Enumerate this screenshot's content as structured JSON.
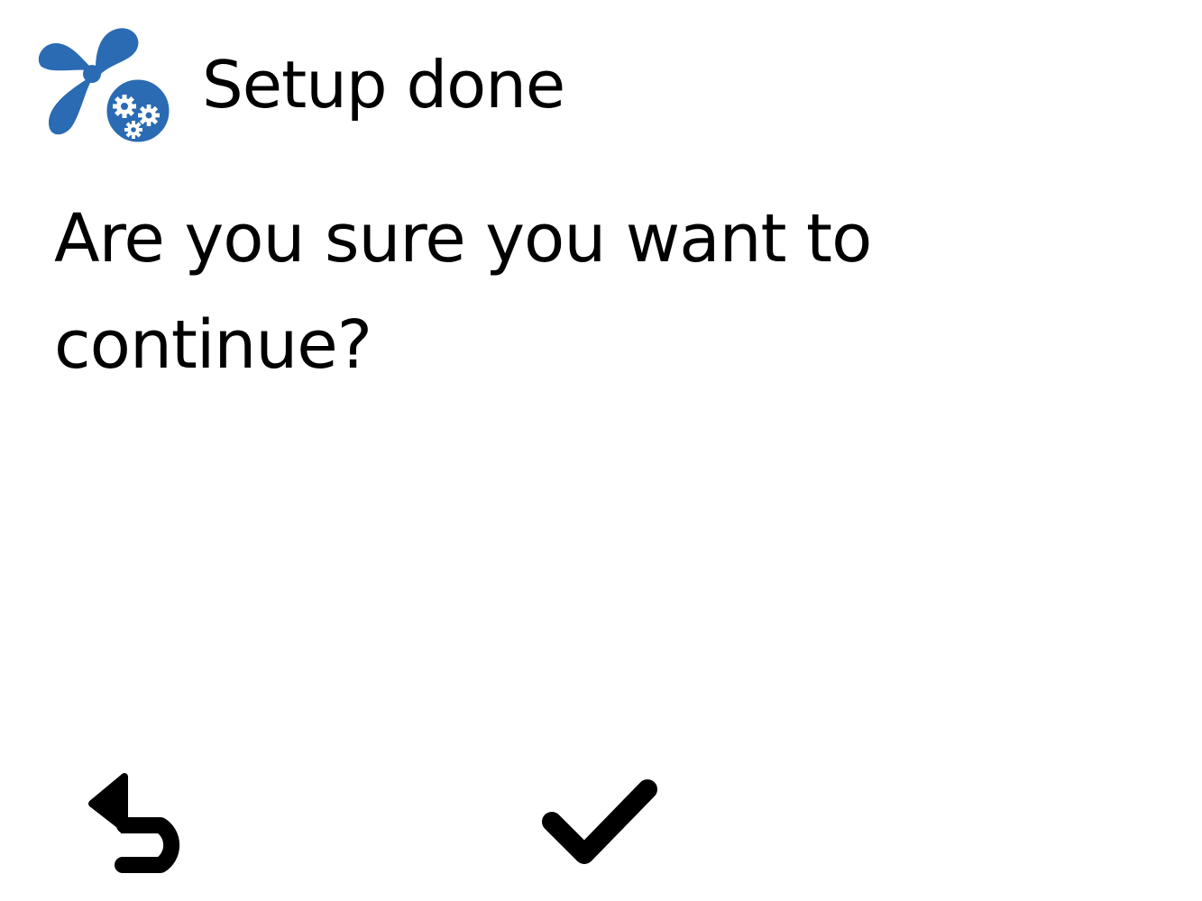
{
  "header": {
    "title": "Setup done",
    "icon": "fan-gears-icon",
    "icon_color": "#2a6bb3"
  },
  "dialog": {
    "message": "Are you sure you want to continue?"
  },
  "actions": {
    "back_icon": "back-arrow-icon",
    "confirm_icon": "checkmark-icon"
  }
}
